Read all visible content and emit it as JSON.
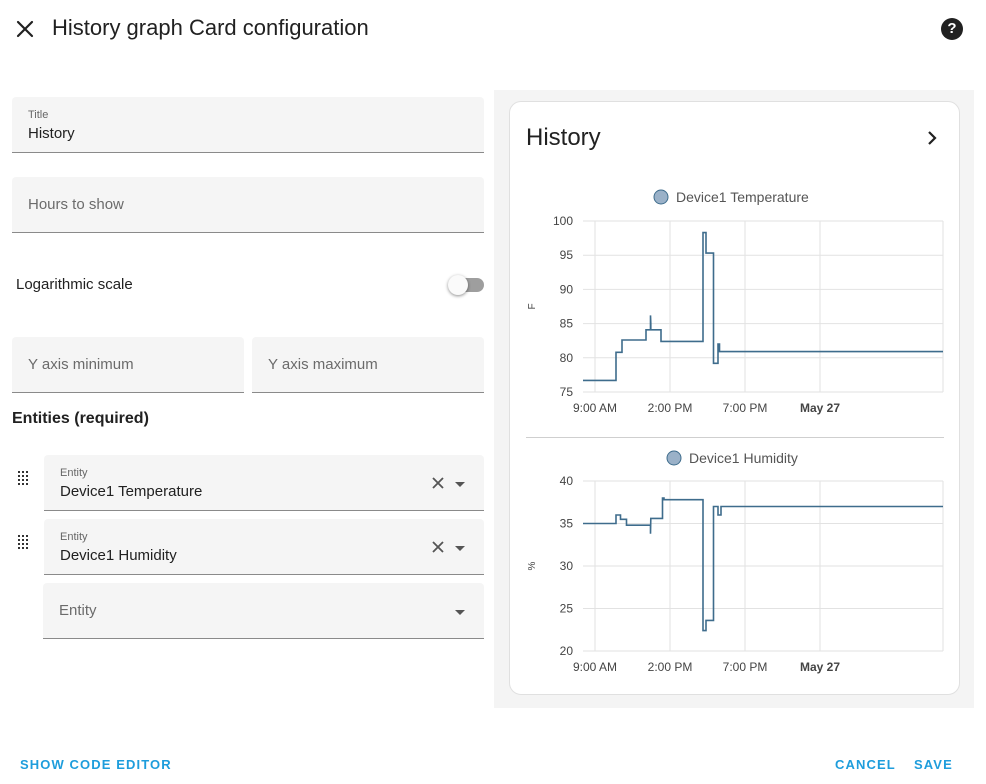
{
  "dialog": {
    "title": "History graph Card configuration",
    "close_icon": "close-icon",
    "help_icon": "help-circle-icon",
    "help_glyph": "?"
  },
  "form": {
    "title_field": {
      "label": "Title",
      "value": "History"
    },
    "hours_field": {
      "placeholder": "Hours to show",
      "value": ""
    },
    "logarithmic": {
      "label": "Logarithmic scale",
      "checked": false
    },
    "y_min_field": {
      "placeholder": "Y axis minimum",
      "value": ""
    },
    "y_max_field": {
      "placeholder": "Y axis maximum",
      "value": ""
    },
    "entities_heading": "Entities (required)",
    "entities": [
      {
        "label": "Entity",
        "value": "Device1 Temperature"
      },
      {
        "label": "Entity",
        "value": "Device1 Humidity"
      }
    ],
    "new_entity": {
      "placeholder": "Entity"
    }
  },
  "footer": {
    "show_code_editor": "SHOW CODE EDITOR",
    "cancel": "CANCEL",
    "save": "SAVE"
  },
  "preview": {
    "card_title": "History",
    "chevron_icon": "chevron-right-icon"
  },
  "colors": {
    "accent": "#1e9ddc",
    "series_line": "#3e6c8c",
    "legend_dot": "#9ab1c8"
  },
  "chart_data": [
    {
      "type": "line",
      "legend": [
        "Device1 Temperature"
      ],
      "xlabel": "",
      "ylabel": "F",
      "x_ticks": [
        "9:00 AM",
        "2:00 PM",
        "7:00 PM",
        "May 27"
      ],
      "y_ticks": [
        100,
        95,
        90,
        85,
        80,
        75
      ],
      "ylim": [
        75,
        100
      ],
      "x_hours_range": [
        8.2,
        32.2
      ],
      "grid": true,
      "legend_position": "top",
      "series": [
        {
          "name": "Device1 Temperature",
          "step": true,
          "x_hours": [
            8.2,
            10.4,
            10.4,
            10.8,
            10.8,
            12.4,
            12.4,
            12.7,
            12.7,
            12.72,
            12.72,
            13.4,
            13.4,
            16.2,
            16.2,
            16.4,
            16.4,
            16.9,
            16.9,
            17.2,
            17.2,
            17.3,
            17.3,
            32.2
          ],
          "values": [
            76.7,
            76.7,
            80.8,
            80.8,
            82.6,
            82.6,
            84.1,
            84.1,
            86.2,
            85.0,
            84.1,
            84.1,
            82.4,
            82.4,
            98.3,
            98.3,
            95.3,
            95.3,
            79.2,
            79.2,
            82.0,
            82.0,
            80.9,
            80.9
          ]
        }
      ]
    },
    {
      "type": "line",
      "legend": [
        "Device1 Humidity"
      ],
      "xlabel": "",
      "ylabel": "%",
      "x_ticks": [
        "9:00 AM",
        "2:00 PM",
        "7:00 PM",
        "May 27"
      ],
      "y_ticks": [
        40,
        35,
        30,
        25,
        20
      ],
      "ylim": [
        20,
        40
      ],
      "x_hours_range": [
        8.2,
        32.2
      ],
      "grid": true,
      "legend_position": "top",
      "series": [
        {
          "name": "Device1 Humidity",
          "step": true,
          "x_hours": [
            8.2,
            10.4,
            10.4,
            10.7,
            10.7,
            11.1,
            11.1,
            12.7,
            12.7,
            12.72,
            12.72,
            13.5,
            13.5,
            13.6,
            13.6,
            16.2,
            16.2,
            16.4,
            16.4,
            16.9,
            16.9,
            17.2,
            17.2,
            17.4,
            17.4,
            32.2
          ],
          "values": [
            35.0,
            35.0,
            36.0,
            36.0,
            35.5,
            35.5,
            34.8,
            34.8,
            33.8,
            35.6,
            35.6,
            35.6,
            38.0,
            38.0,
            37.8,
            37.8,
            22.4,
            22.4,
            23.6,
            23.6,
            37.0,
            37.0,
            36.0,
            36.0,
            37.0,
            37.0
          ]
        }
      ]
    }
  ]
}
